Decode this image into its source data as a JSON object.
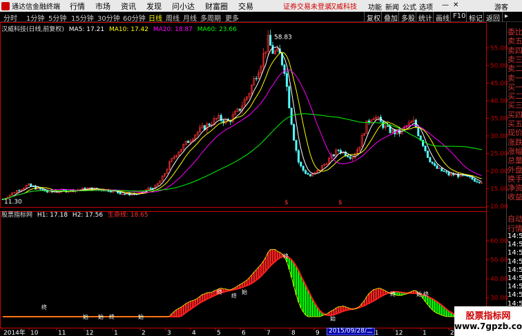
{
  "app": {
    "title": "通达信金融终端",
    "menus": [
      "行情",
      "市场",
      "资讯",
      "发现",
      "问小达",
      "财富圈",
      "交易"
    ],
    "alert": "证券交易未登录",
    "stock_name_top": "汉威科技",
    "right_menus": [
      "功能",
      "新闻",
      "公式",
      "选项"
    ],
    "user": "游客"
  },
  "toolbar": {
    "periods": [
      "分时",
      "1分钟",
      "5分钟",
      "15分钟",
      "30分钟",
      "60分钟",
      "日线",
      "周线",
      "月线",
      "多周期",
      "更多"
    ],
    "active_period": "日线",
    "right_buttons": [
      "复权",
      "叠加",
      "多股",
      "统计",
      "画线",
      "F10",
      "标记",
      "返回"
    ]
  },
  "main_legend": {
    "title": "汉威科技(日线,前复权)",
    "ma": [
      {
        "label": "MA5: 17.21",
        "color": "#ffffff"
      },
      {
        "label": "MA10: 17.42",
        "color": "#ffff00"
      },
      {
        "label": "MA20: 18.87",
        "color": "#ff00ff"
      },
      {
        "label": "MA60: 23.66",
        "color": "#00ff00"
      }
    ]
  },
  "price_axis": {
    "labels": [
      "55.00",
      "50.00",
      "45.00",
      "40.00",
      "35.00",
      "30.00",
      "25.00",
      "20.00",
      "15.00",
      "10.00"
    ],
    "values": [
      55,
      50,
      45,
      40,
      35,
      30,
      25,
      20,
      15,
      10
    ],
    "high_label": "58.83",
    "low_label": "11.30"
  },
  "sub_legend": {
    "title": "股票指标网",
    "h1": "H1: 17.18",
    "h2": "H2: 17.56",
    "lifeline": "生命线: 18.65"
  },
  "sub_axis": {
    "labels": [
      "60.00",
      "50.00",
      "40.00",
      "30.00",
      "20.00"
    ],
    "values": [
      60,
      50,
      40,
      30,
      20
    ]
  },
  "signals": {
    "buy": "始",
    "end": "终",
    "marker": "$"
  },
  "right_panel": {
    "quote_items": [
      "委比",
      "卖五",
      "卖四",
      "卖三",
      "卖二",
      "卖一",
      "买一",
      "买二",
      "买三",
      "买四",
      "买五",
      "现价",
      "涨跌",
      "涨幅",
      "总量",
      "外盘",
      "换手",
      "净资",
      "收益"
    ],
    "tick_header": [
      "自动",
      "行情"
    ],
    "ticks": [
      "14:56",
      "14:56",
      "14:56",
      "14:56",
      "14:56",
      "14:56",
      "14:56",
      "14:56",
      "14:56"
    ]
  },
  "date_axis": {
    "labels": [
      "2014年",
      "10",
      "11",
      "12",
      "1",
      "2",
      "3",
      "4",
      "5",
      "6",
      "7",
      "8",
      "9",
      "11",
      "12",
      "1",
      "2"
    ],
    "selected": "2015/09/28/二"
  },
  "watermark": {
    "line1": "股票指标网",
    "line2": "www.7gpzb.com"
  },
  "colors": {
    "up": "#ff3232",
    "down": "#00ff00",
    "axis": "#cc0000",
    "ma5": "#ffffff",
    "ma10": "#ffff00",
    "ma20": "#ff00ff",
    "ma60": "#00ff00"
  }
}
